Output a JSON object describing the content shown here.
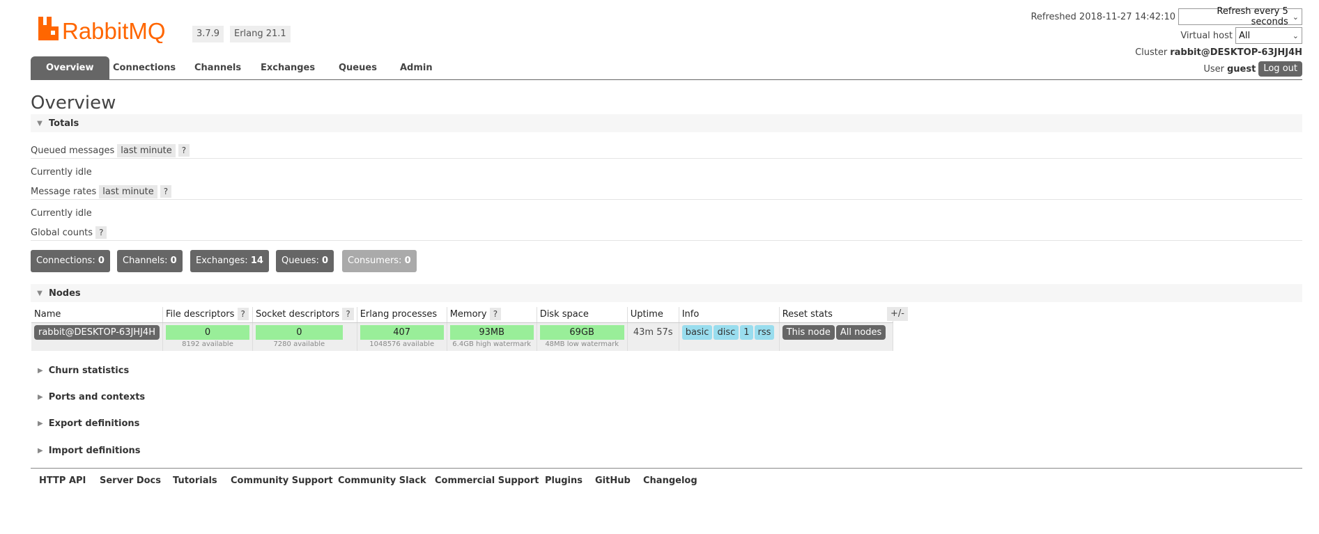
{
  "app": {
    "logo_text": "RabbitMQ",
    "version": "3.7.9",
    "erlang": "Erlang 21.1",
    "brand_color": "#f60",
    "accent_color": "#666666"
  },
  "topright": {
    "refreshed_label": "Refreshed 2018-11-27 14:42:10",
    "refresh_select": "Refresh every 5 seconds",
    "vhost_label": "Virtual host",
    "vhost_select": "All",
    "cluster_label": "Cluster",
    "cluster_name": "rabbit@DESKTOP-63JHJ4H",
    "user_label": "User",
    "user_name": "guest",
    "logout": "Log out"
  },
  "tabs": [
    {
      "label": "Overview",
      "active": true
    },
    {
      "label": "Connections",
      "active": false
    },
    {
      "label": "Channels",
      "active": false
    },
    {
      "label": "Exchanges",
      "active": false
    },
    {
      "label": "Queues",
      "active": false
    },
    {
      "label": "Admin",
      "active": false
    }
  ],
  "main": {
    "title": "Overview",
    "totals": {
      "heading": "Totals",
      "queued_messages": "Queued messages",
      "queued_range": "last minute",
      "q_mark": "?",
      "idle_1": "Currently idle",
      "message_rates": "Message rates",
      "rates_range": "last minute",
      "idle_2": "Currently idle",
      "global_counts": "Global counts",
      "counts": [
        {
          "label": "Connections:",
          "value": "0"
        },
        {
          "label": "Channels:",
          "value": "0"
        },
        {
          "label": "Exchanges:",
          "value": "14"
        },
        {
          "label": "Queues:",
          "value": "0"
        },
        {
          "label": "Consumers:",
          "value": "0"
        }
      ]
    },
    "nodes": {
      "heading": "Nodes",
      "columns": [
        "Name",
        "File descriptors",
        "Socket descriptors",
        "Erlang processes",
        "Memory",
        "Disk space",
        "Uptime",
        "Info",
        "Reset stats"
      ],
      "plusminus": "+/-",
      "row": {
        "name": "rabbit@DESKTOP-63JHJ4H",
        "fd": "0",
        "fd_sub": "8192 available",
        "sd": "0",
        "sd_sub": "7280 available",
        "ep": "407",
        "ep_sub": "1048576 available",
        "mem": "93MB",
        "mem_sub": "6.4GB high watermark",
        "disk": "69GB",
        "disk_sub": "48MB low watermark",
        "uptime": "43m 57s",
        "info": [
          "basic",
          "disc",
          "1",
          "rss"
        ],
        "reset_this": "This node",
        "reset_all": "All nodes"
      }
    },
    "collapsed_sections": [
      "Churn statistics",
      "Ports and contexts",
      "Export definitions",
      "Import definitions"
    ]
  },
  "footer": {
    "links": [
      "HTTP API",
      "Server Docs",
      "Tutorials",
      "Community Support",
      "Community Slack",
      "Commercial Support",
      "Plugins",
      "GitHub",
      "Changelog"
    ]
  }
}
